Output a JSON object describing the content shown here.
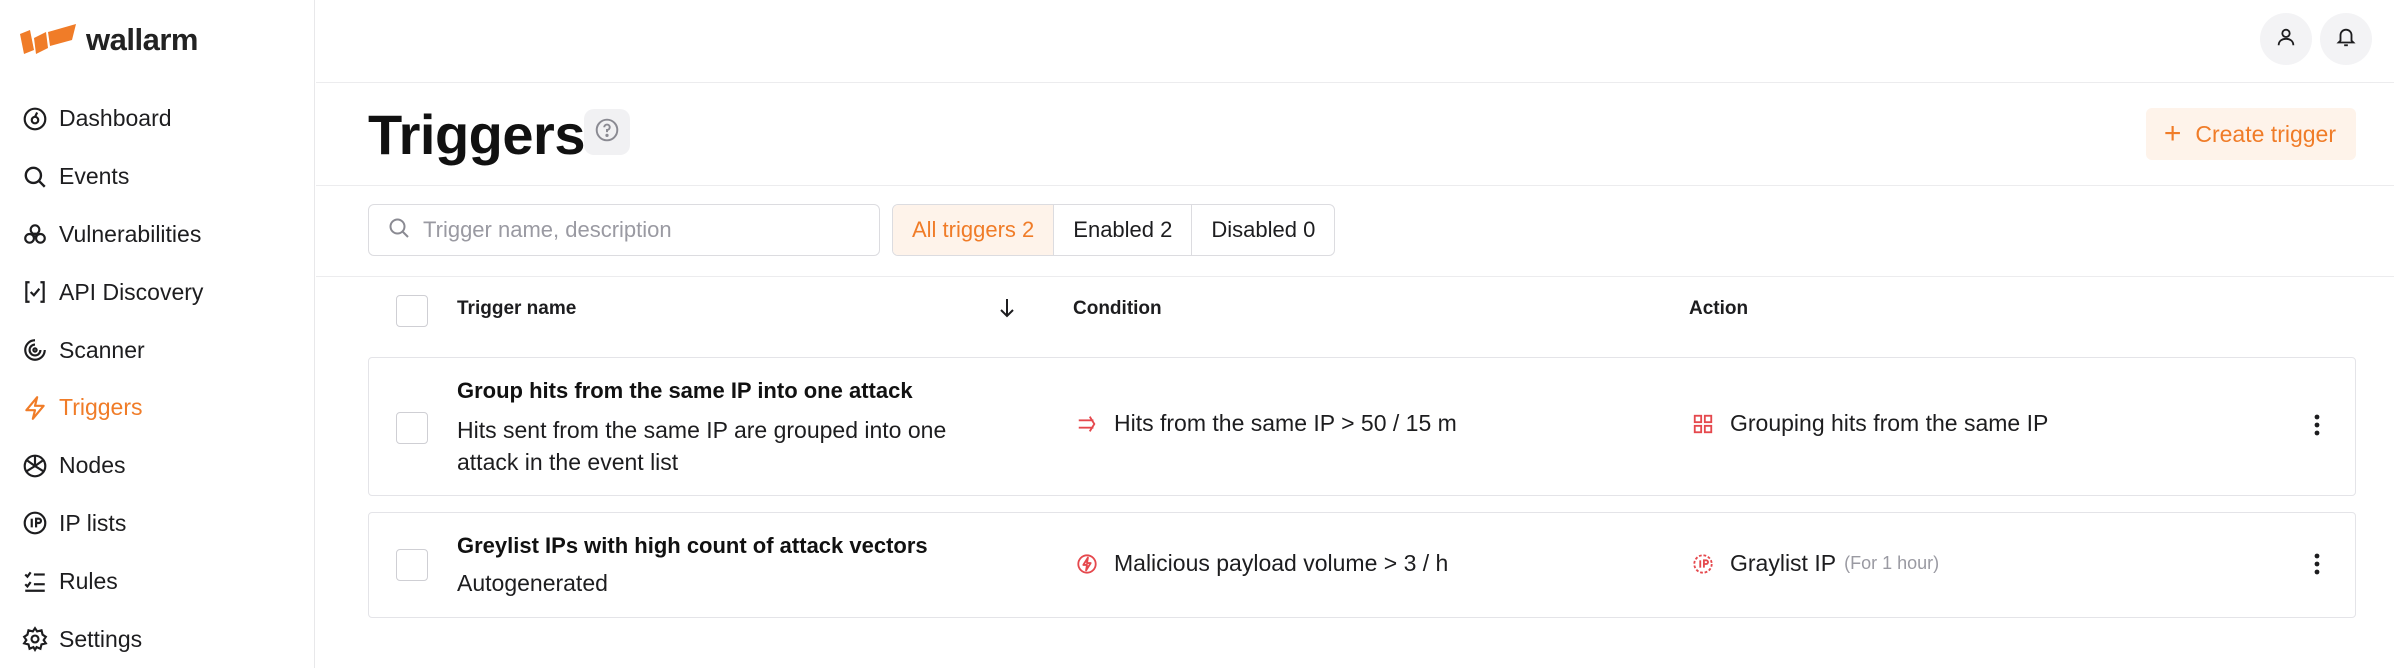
{
  "app": {
    "brand": "wallarm",
    "accent": "#f07c28",
    "danger": "#e5484d"
  },
  "sidebar": {
    "items": [
      {
        "label": "Dashboard",
        "icon": "dashboard-icon"
      },
      {
        "label": "Events",
        "icon": "search-icon"
      },
      {
        "label": "Vulnerabilities",
        "icon": "biohazard-icon"
      },
      {
        "label": "API Discovery",
        "icon": "api-discovery-icon"
      },
      {
        "label": "Scanner",
        "icon": "scanner-icon"
      },
      {
        "label": "Triggers",
        "icon": "lightning-icon",
        "active": true
      },
      {
        "label": "Nodes",
        "icon": "nodes-icon"
      },
      {
        "label": "IP lists",
        "icon": "ip-icon"
      },
      {
        "label": "Rules",
        "icon": "checklist-icon"
      },
      {
        "label": "Settings",
        "icon": "gear-icon"
      }
    ]
  },
  "header": {
    "title": "Triggers",
    "create_label": "Create trigger"
  },
  "filters": {
    "search_placeholder": "Trigger name, description",
    "tabs": [
      {
        "label": "All triggers 2",
        "active": true
      },
      {
        "label": "Enabled 2"
      },
      {
        "label": "Disabled 0"
      }
    ]
  },
  "table": {
    "columns": [
      "Trigger name",
      "Condition",
      "Action"
    ],
    "rows": [
      {
        "name": "Group hits from the same IP into one attack",
        "description": "Hits sent from the same IP are grouped into one attack in the event list",
        "condition": "Hits from the same IP > 50 / 15 m",
        "condition_icon": "double-arrow-icon",
        "action": "Grouping hits from the same IP",
        "action_icon": "grid-icon",
        "action_note": ""
      },
      {
        "name": "Greylist IPs with high count of attack vectors",
        "description": "Autogenerated",
        "condition": "Malicious payload volume > 3 / h",
        "condition_icon": "lightning-circle-icon",
        "action": "Graylist IP",
        "action_icon": "ip-graylist-icon",
        "action_note": "(For 1 hour)"
      }
    ]
  }
}
